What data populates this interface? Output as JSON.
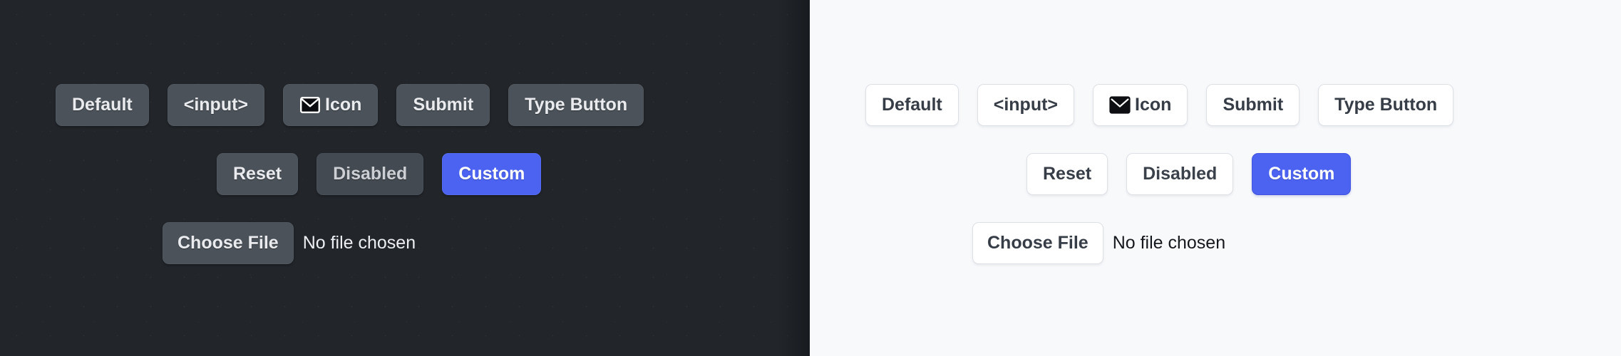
{
  "panels": [
    {
      "theme": "dark",
      "background_color": "#22262B",
      "button_fill": "#4B5259",
      "button_text_color": "#E9EBEE",
      "accent_color": "#4B63F0",
      "rows": {
        "row1": [
          {
            "label": "Default",
            "icon": null
          },
          {
            "label": "<input>",
            "icon": null
          },
          {
            "label": "Icon",
            "icon": "envelope-icon"
          },
          {
            "label": "Submit",
            "icon": null
          },
          {
            "label": "Type Button",
            "icon": null
          }
        ],
        "row2": [
          {
            "label": "Reset",
            "state": "normal"
          },
          {
            "label": "Disabled",
            "state": "disabled"
          },
          {
            "label": "Custom",
            "state": "custom"
          }
        ],
        "row3": {
          "button_label": "Choose File",
          "status_text": "No file chosen"
        }
      }
    },
    {
      "theme": "light",
      "background_color": "#F8F9FB",
      "button_fill": "#FFFFFF",
      "button_border_color": "#DDE1E6",
      "button_text_color": "#363D47",
      "accent_color": "#4B63F0",
      "rows": {
        "row1": [
          {
            "label": "Default",
            "icon": null
          },
          {
            "label": "<input>",
            "icon": null
          },
          {
            "label": "Icon",
            "icon": "envelope-icon"
          },
          {
            "label": "Submit",
            "icon": null
          },
          {
            "label": "Type Button",
            "icon": null
          }
        ],
        "row2": [
          {
            "label": "Reset",
            "state": "normal"
          },
          {
            "label": "Disabled",
            "state": "disabled"
          },
          {
            "label": "Custom",
            "state": "custom"
          }
        ],
        "row3": {
          "button_label": "Choose File",
          "status_text": "No file chosen"
        }
      }
    }
  ]
}
